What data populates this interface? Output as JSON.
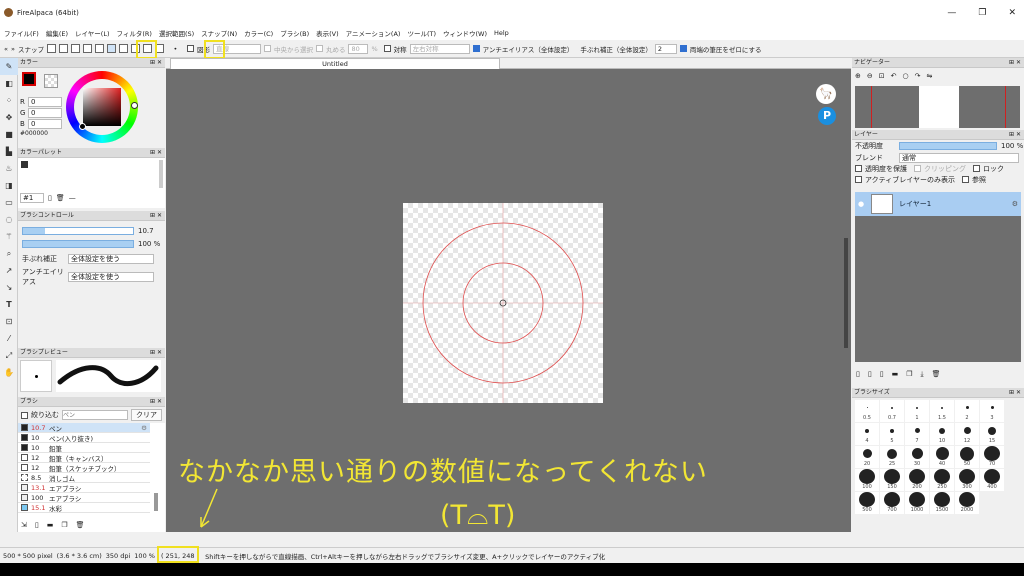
{
  "window": {
    "title": "FireAlpaca (64bit)",
    "minimize": "—",
    "restore": "❐",
    "close": "✕"
  },
  "menu": [
    "ファイル(F)",
    "編集(E)",
    "レイヤー(L)",
    "フィルタ(R)",
    "選択範囲(S)",
    "スナップ(N)",
    "カラー(C)",
    "ブラシ(B)",
    "表示(V)",
    "アニメーション(A)",
    "ツール(T)",
    "ウィンドウ(W)",
    "Help"
  ],
  "toolbar": {
    "snap": "スナップ",
    "shape": "図形",
    "shape_mode": "直線",
    "center_select": "中央から選択",
    "round": "丸める",
    "round_value": "80",
    "round_unit": "%",
    "symmetry": "対称",
    "symmetry_mode": "左右対称",
    "antialias": "アンチエイリアス（全体設定）",
    "stabilizer": "手ぶれ補正（全体設定）",
    "stabilizer_value": "2",
    "zero_pressure": "両端の筆圧をゼロにする"
  },
  "left": {
    "color_panel": "カラー",
    "rgb": [
      {
        "k": "R",
        "v": "0"
      },
      {
        "k": "G",
        "v": "0"
      },
      {
        "k": "B",
        "v": "0"
      }
    ],
    "hex": "#000000",
    "palette_panel": "カラーパレット",
    "palette_set": "#1",
    "brush_control": "ブラシコントロール",
    "size_value": "10.7",
    "opacity_value": "100 %",
    "stab_label": "手ぶれ補正",
    "stab_value": "全体設定を使う",
    "aa_label": "アンチエイリアス",
    "aa_value": "全体設定を使う",
    "preview_panel": "ブラシプレビュー",
    "brush_panel": "ブラシ",
    "filter": "絞り込む",
    "filter_placeholder": "ペン",
    "clear": "クリア",
    "brushes": [
      {
        "size": "10.7",
        "name": "ペン",
        "sel": true,
        "red": true
      },
      {
        "size": "10",
        "name": "ペン(入り抜き)"
      },
      {
        "size": "10",
        "name": "鉛筆"
      },
      {
        "size": "12",
        "name": "鉛筆（キャンバス）"
      },
      {
        "size": "12",
        "name": "鉛筆（スケッチブック）"
      },
      {
        "size": "8.5",
        "name": "消しゴム"
      },
      {
        "size": "13.1",
        "name": "エアブラシ",
        "red": true
      },
      {
        "size": "100",
        "name": "エアブラシ"
      },
      {
        "size": "15.1",
        "name": "水彩",
        "red": true
      }
    ]
  },
  "canvas": {
    "tab": "Untitled"
  },
  "right": {
    "navigator": "ナビゲーター",
    "layer_panel": "レイヤー",
    "opacity_label": "不透明度",
    "opacity_value": "100 %",
    "blend_label": "ブレンド",
    "blend_value": "通常",
    "protect_alpha": "透明度を保護",
    "clipping": "クリッピング",
    "lock": "ロック",
    "active_only": "アクティブレイヤーのみ表示",
    "reference": "参照",
    "layer_name": "レイヤー1",
    "brush_size_panel": "ブラシサイズ",
    "sizes": [
      "0.5",
      "0.7",
      "1",
      "1.5",
      "2",
      "3",
      "4",
      "5",
      "7",
      "10",
      "12",
      "15",
      "20",
      "25",
      "30",
      "40",
      "50",
      "70",
      "100",
      "150",
      "200",
      "250",
      "300",
      "400",
      "500",
      "700",
      "1000",
      "1500",
      "2000"
    ]
  },
  "status": {
    "size": "500 * 500 pixel",
    "cm": "(3.6 * 3.6 cm)",
    "dpi": "350 dpi",
    "zoom": "100 %",
    "coords": "( 251, 248 )",
    "hint": "Shiftキーを押しながらで直線描画、Ctrl+Altキーを押しながら左右ドラッグでブラシサイズ変更、A+クリックでレイヤーのアクティブ化"
  },
  "annotation": {
    "line1": "なかなか思い通りの数値になってくれない",
    "line2": "(T⌓T)"
  },
  "colors": {
    "accent": "#2f6fd0",
    "highlight": "#f0e020",
    "annotation": "#f2e634",
    "canvas_bg": "#6e6e6e",
    "guide": "#e04a4a"
  }
}
